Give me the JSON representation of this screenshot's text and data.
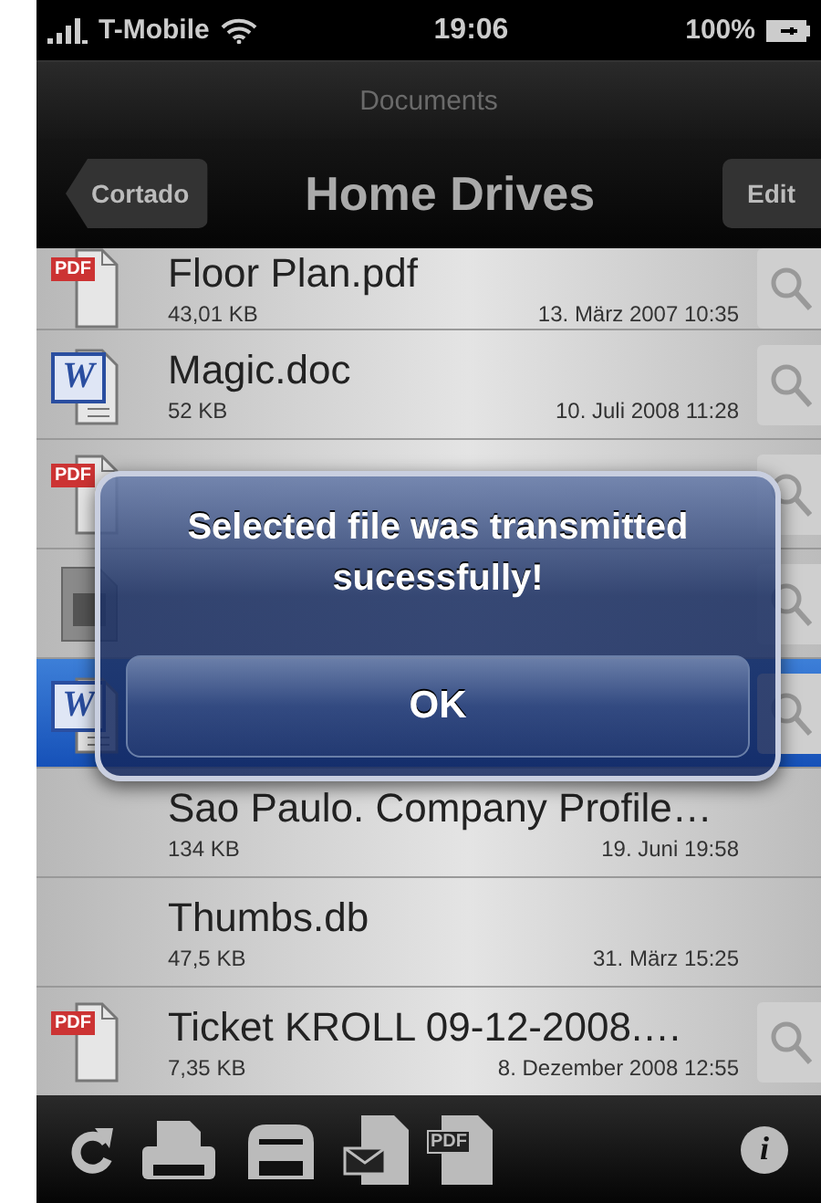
{
  "status_bar": {
    "carrier": "T-Mobile",
    "time": "19:06",
    "battery": "100%"
  },
  "prompt": "Documents",
  "nav": {
    "back": "Cortado",
    "title": "Home Drives",
    "action": "Edit"
  },
  "files": [
    {
      "kind": "pdf",
      "badge": "PDF",
      "name": "Floor Plan.pdf",
      "size": "43,01 KB",
      "date": "13. März 2007 10:35",
      "preview": true,
      "selected": false
    },
    {
      "kind": "word",
      "badge": "W",
      "name": "Magic.doc",
      "size": "52 KB",
      "date": "10. Juli 2008 11:28",
      "preview": true,
      "selected": false
    },
    {
      "kind": "pdf",
      "badge": "PDF",
      "preview": true,
      "selected": false
    },
    {
      "kind": "file",
      "preview": true,
      "selected": false
    },
    {
      "kind": "word",
      "badge": "W",
      "preview": true,
      "selected": true
    },
    {
      "kind": "none",
      "name": "Sao Paulo. Company Profile…",
      "size": "134 KB",
      "date": "19. Juni 19:58",
      "preview": false,
      "selected": false
    },
    {
      "kind": "none",
      "name": "Thumbs.db",
      "size": "47,5 KB",
      "date": "31. März 15:25",
      "preview": false,
      "selected": false
    },
    {
      "kind": "pdf",
      "badge": "PDF",
      "name": "Ticket KROLL 09-12-2008.…",
      "size": "7,35 KB",
      "date": "8. Dezember 2008 12:55",
      "preview": true,
      "selected": false
    }
  ],
  "alert": {
    "message": "Selected file was transmitted sucessfully!",
    "button": "OK"
  },
  "toolbar": [
    {
      "kind": "refresh"
    },
    {
      "kind": "printer"
    },
    {
      "kind": "fax"
    },
    {
      "kind": "mail"
    },
    {
      "kind": "pdf",
      "label": "PDF"
    },
    {
      "kind": "info",
      "label": "i"
    }
  ]
}
